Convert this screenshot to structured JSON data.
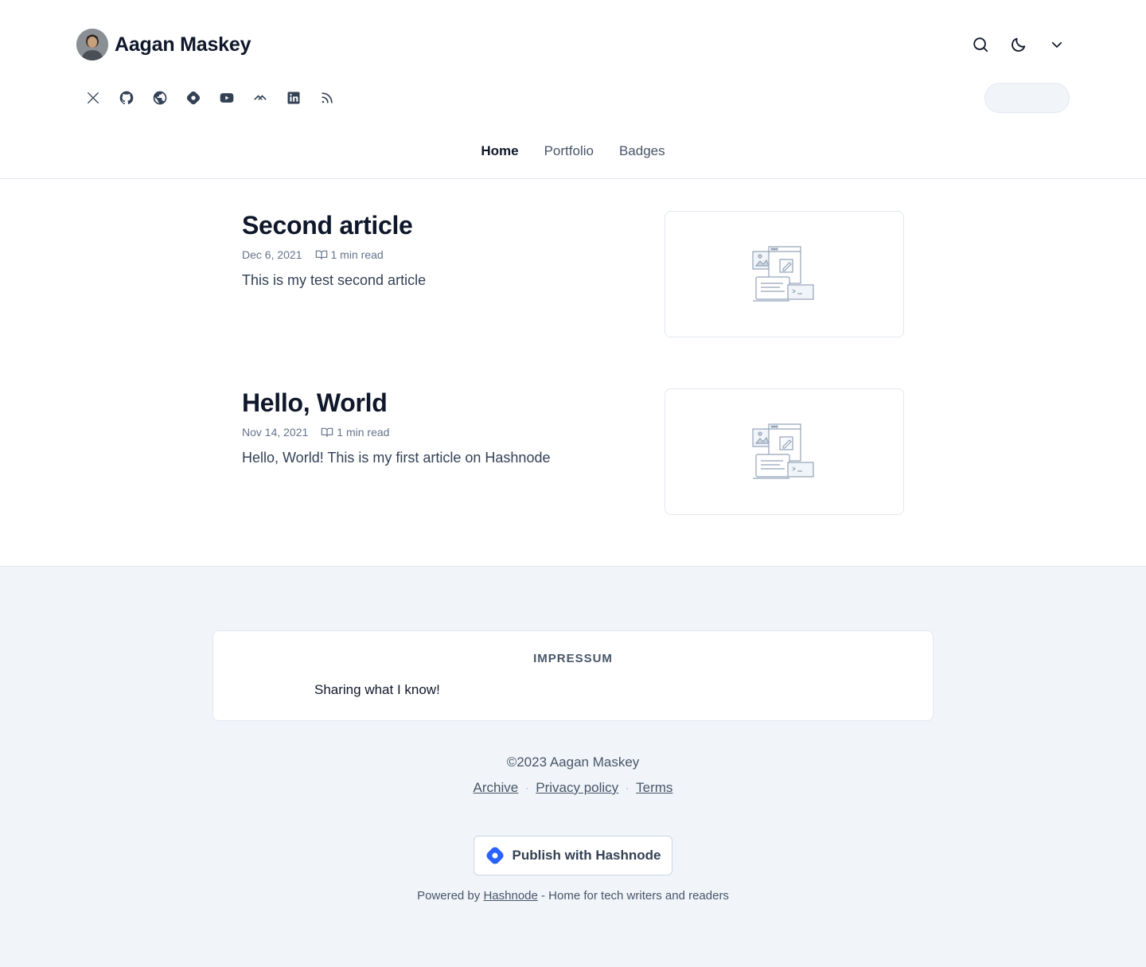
{
  "blog": {
    "name": "Aagan Maskey",
    "avatar_icon": "avatar-photo"
  },
  "header_actions": [
    "search-icon",
    "moon-icon",
    "chevron-down-icon"
  ],
  "socials": [
    {
      "name": "x-twitter-icon"
    },
    {
      "name": "github-icon"
    },
    {
      "name": "globe-icon"
    },
    {
      "name": "hashnode-icon"
    },
    {
      "name": "youtube-icon"
    },
    {
      "name": "stackoverflow-icon"
    },
    {
      "name": "linkedin-icon"
    },
    {
      "name": "rss-icon"
    }
  ],
  "nav": {
    "items": [
      {
        "label": "Home",
        "active": true
      },
      {
        "label": "Portfolio",
        "active": false
      },
      {
        "label": "Badges",
        "active": false
      }
    ]
  },
  "posts": [
    {
      "title": "Second article",
      "date": "Dec 6, 2021",
      "read_time": "1 min read",
      "brief": "This is my test second article"
    },
    {
      "title": "Hello, World",
      "date": "Nov 14, 2021",
      "read_time": "1 min read",
      "brief": "Hello, World! This is my first article on Hashnode"
    }
  ],
  "footer": {
    "impressum_title": "IMPRESSUM",
    "impressum_text": "Sharing what I know!",
    "copyright": "©2023 Aagan Maskey",
    "links": [
      "Archive",
      "Privacy policy",
      "Terms"
    ],
    "separator": "·",
    "publish_label": "Publish with Hashnode",
    "powered_prefix": "Powered by",
    "powered_link": "Hashnode",
    "powered_suffix": "- Home for tech writers and readers"
  },
  "colors": {
    "accent": "#2962FF",
    "text": "#0f172a",
    "muted": "#475569",
    "footer_bg": "#f1f5f9"
  }
}
